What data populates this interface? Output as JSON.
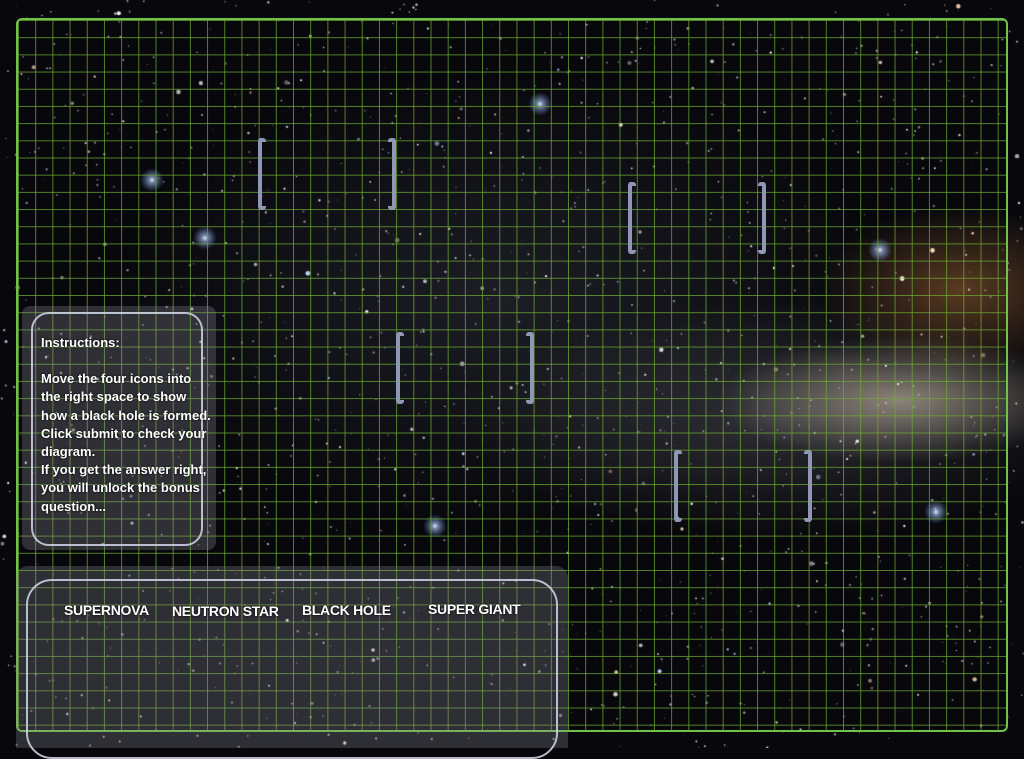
{
  "instructions": {
    "title": "Instructions:",
    "body": "Move the four icons into the right space to show how a black hole is formed. Click submit to check your diagram.",
    "extra": "If you get the answer right, you will unlock the bonus question..."
  },
  "icons": [
    {
      "label": "SUPERNOVA"
    },
    {
      "label": "NEUTRON STAR"
    },
    {
      "label": "BLACK HOLE"
    },
    {
      "label": "SUPER GIANT"
    }
  ],
  "colors": {
    "grid": "#6fc24a",
    "bracket": "#8f97b5",
    "panel_border": "#d2d7eb"
  }
}
